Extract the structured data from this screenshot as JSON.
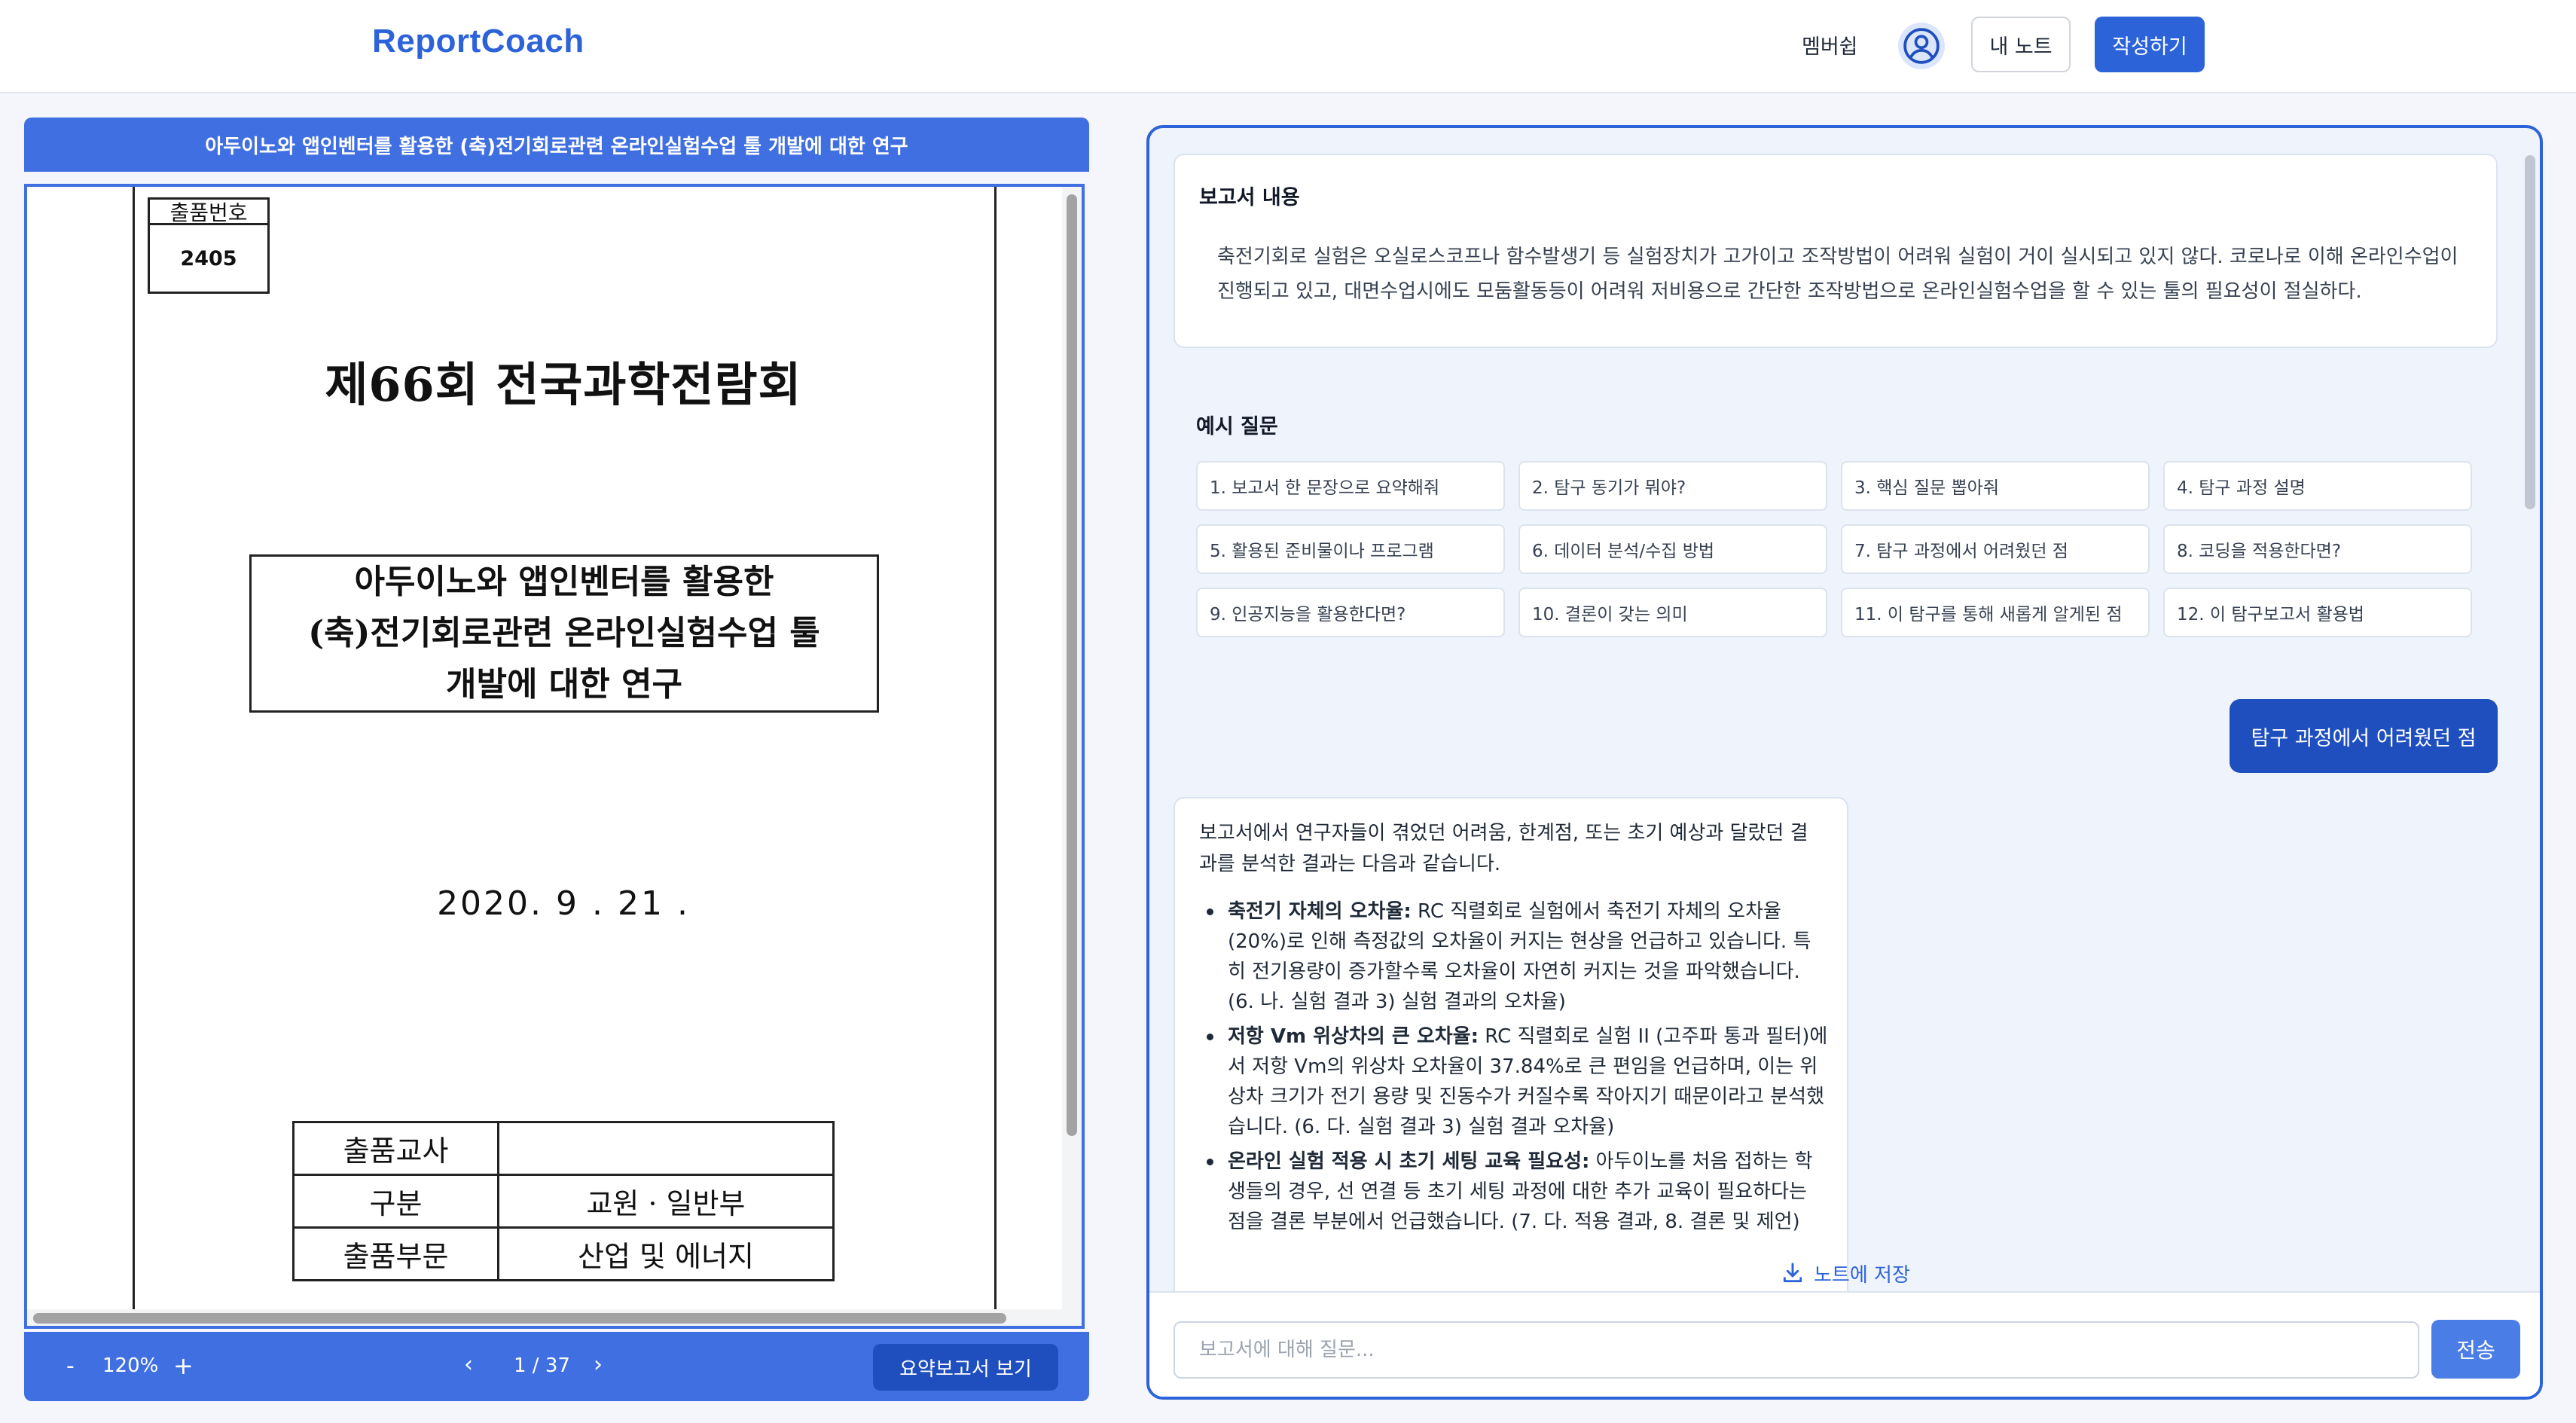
{
  "header": {
    "logo": "ReportCoach",
    "nav_membership": "멤버쉽",
    "my_notes_label": "내 노트",
    "write_label": "작성하기"
  },
  "document": {
    "title": "아두이노와 앱인벤터를 활용한 (축)전기회로관련 온라인실험수업 툴 개발에 대한 연구",
    "page": {
      "id_label": "출품번호",
      "id_value": "2405",
      "conference": "제66회 전국과학전람회",
      "paper_title_lines": [
        "아두이노와 앱인벤터를 활용한",
        "(축)전기회로관련 온라인실험수업 툴",
        "개발에 대한 연구"
      ],
      "date": "2020.  9 . 21 .",
      "table": [
        {
          "key": "출품교사",
          "value": ""
        },
        {
          "key": "구분",
          "value": "교원 · 일반부"
        },
        {
          "key": "출품부문",
          "value": "산업 및 에너지"
        }
      ]
    },
    "toolbar": {
      "zoom_out": "-",
      "zoom_level": "120%",
      "zoom_in": "+",
      "prev": "‹",
      "page_indicator": "1 / 37",
      "next": "›",
      "summary_button": "요약보고서 보기"
    }
  },
  "chat": {
    "report_card": {
      "title": "보고서 내용",
      "body": "축전기회로 실험은 오실로스코프나 함수발생기 등 실험장치가 고가이고 조작방법이 어려워 실험이 거이 실시되고 있지 않다. 코로나로 이해 온라인수업이 진행되고 있고, 대면수업시에도 모둠활동등이 어려워 저비용으로 간단한 조작방법으로 온라인실험수업을 할 수 있는 툴의 필요성이 절실하다."
    },
    "examples_title": "예시 질문",
    "examples": [
      "1. 보고서 한 문장으로 요약해줘",
      "2. 탐구 동기가 뭐야?",
      "3. 핵심 질문 뽑아줘",
      "4. 탐구 과정 설명",
      "5. 활용된 준비물이나 프로그램",
      "6. 데이터 분석/수집 방법",
      "7. 탐구 과정에서 어려웠던 점",
      "8. 코딩을 적용한다면?",
      "9. 인공지능을 활용한다면?",
      "10. 결론이 갖는 의미",
      "11. 이 탐구를 통해 새롭게 알게된 점",
      "12. 이 탐구보고서 활용법"
    ],
    "user_message": "탐구 과정에서 어려웠던 점",
    "answer": {
      "intro": "보고서에서 연구자들이 겪었던 어려움, 한계점, 또는 초기 예상과 달랐던 결과를 분석한 결과는 다음과 같습니다.",
      "items": [
        {
          "bold": "축전기 자체의 오차율:",
          "text": " RC 직렬회로 실험에서 축전기 자체의 오차율(20%)로 인해 측정값의 오차율이 커지는 현상을 언급하고 있습니다. 특히 전기용량이 증가할수록 오차율이 자연히 커지는 것을 파악했습니다. (6. 나. 실험 결과 3) 실험 결과의 오차율)"
        },
        {
          "bold": "저항 Vm 위상차의 큰 오차율:",
          "text": " RC 직렬회로 실험 II (고주파 통과 필터)에서 저항 Vm의 위상차 오차율이 37.84%로 큰 편임을 언급하며, 이는 위상차 크기가 전기 용량 및 진동수가 커질수록 작아지기 때문이라고 분석했습니다. (6. 다. 실험 결과 3) 실험 결과 오차율)"
        },
        {
          "bold": "온라인 실험 적용 시 초기 세팅 교육 필요성:",
          "text": " 아두이노를 처음 접하는 학생들의 경우, 선 연결 등 초기 세팅 과정에 대한 추가 교육이 필요하다는 점을 결론 부분에서 언급했습니다. (7. 다. 적용 결과, 8. 결론 및 제언)"
        }
      ]
    },
    "save_note": "노트에 저장",
    "input_placeholder": "보고서에 대해 질문...",
    "send_label": "전송"
  },
  "colors": {
    "brand": "#2d63d9",
    "toolbar": "#3f6fe0",
    "dark_button": "#1f4fbf"
  }
}
